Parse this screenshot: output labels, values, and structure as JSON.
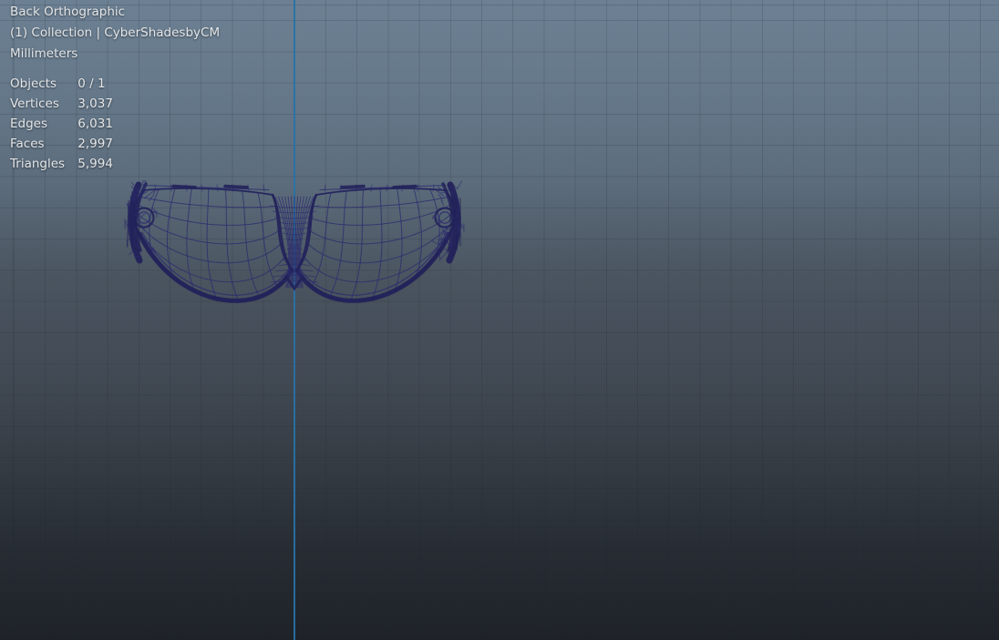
{
  "header": {
    "view_label": "Back Orthographic",
    "collection_label": "(1) Collection | CyberShadesbyCM",
    "units_label": "Millimeters"
  },
  "stats": {
    "rows": [
      {
        "label": "Objects",
        "value": "0 / 1"
      },
      {
        "label": "Vertices",
        "value": "3,037"
      },
      {
        "label": "Edges",
        "value": "6,031"
      },
      {
        "label": "Faces",
        "value": "2,997"
      },
      {
        "label": "Triangles",
        "value": "5,994"
      }
    ]
  },
  "colors": {
    "bg_top": "#6c8093",
    "bg_mid": "#49545f",
    "bg_bottom": "#1d2127",
    "grid_line": "rgba(28,36,46,0.17)",
    "axis_z": "#2673a8",
    "wire": "#2b2b6e",
    "wire_thick": "#22225a",
    "text": "#e4e6e8"
  }
}
